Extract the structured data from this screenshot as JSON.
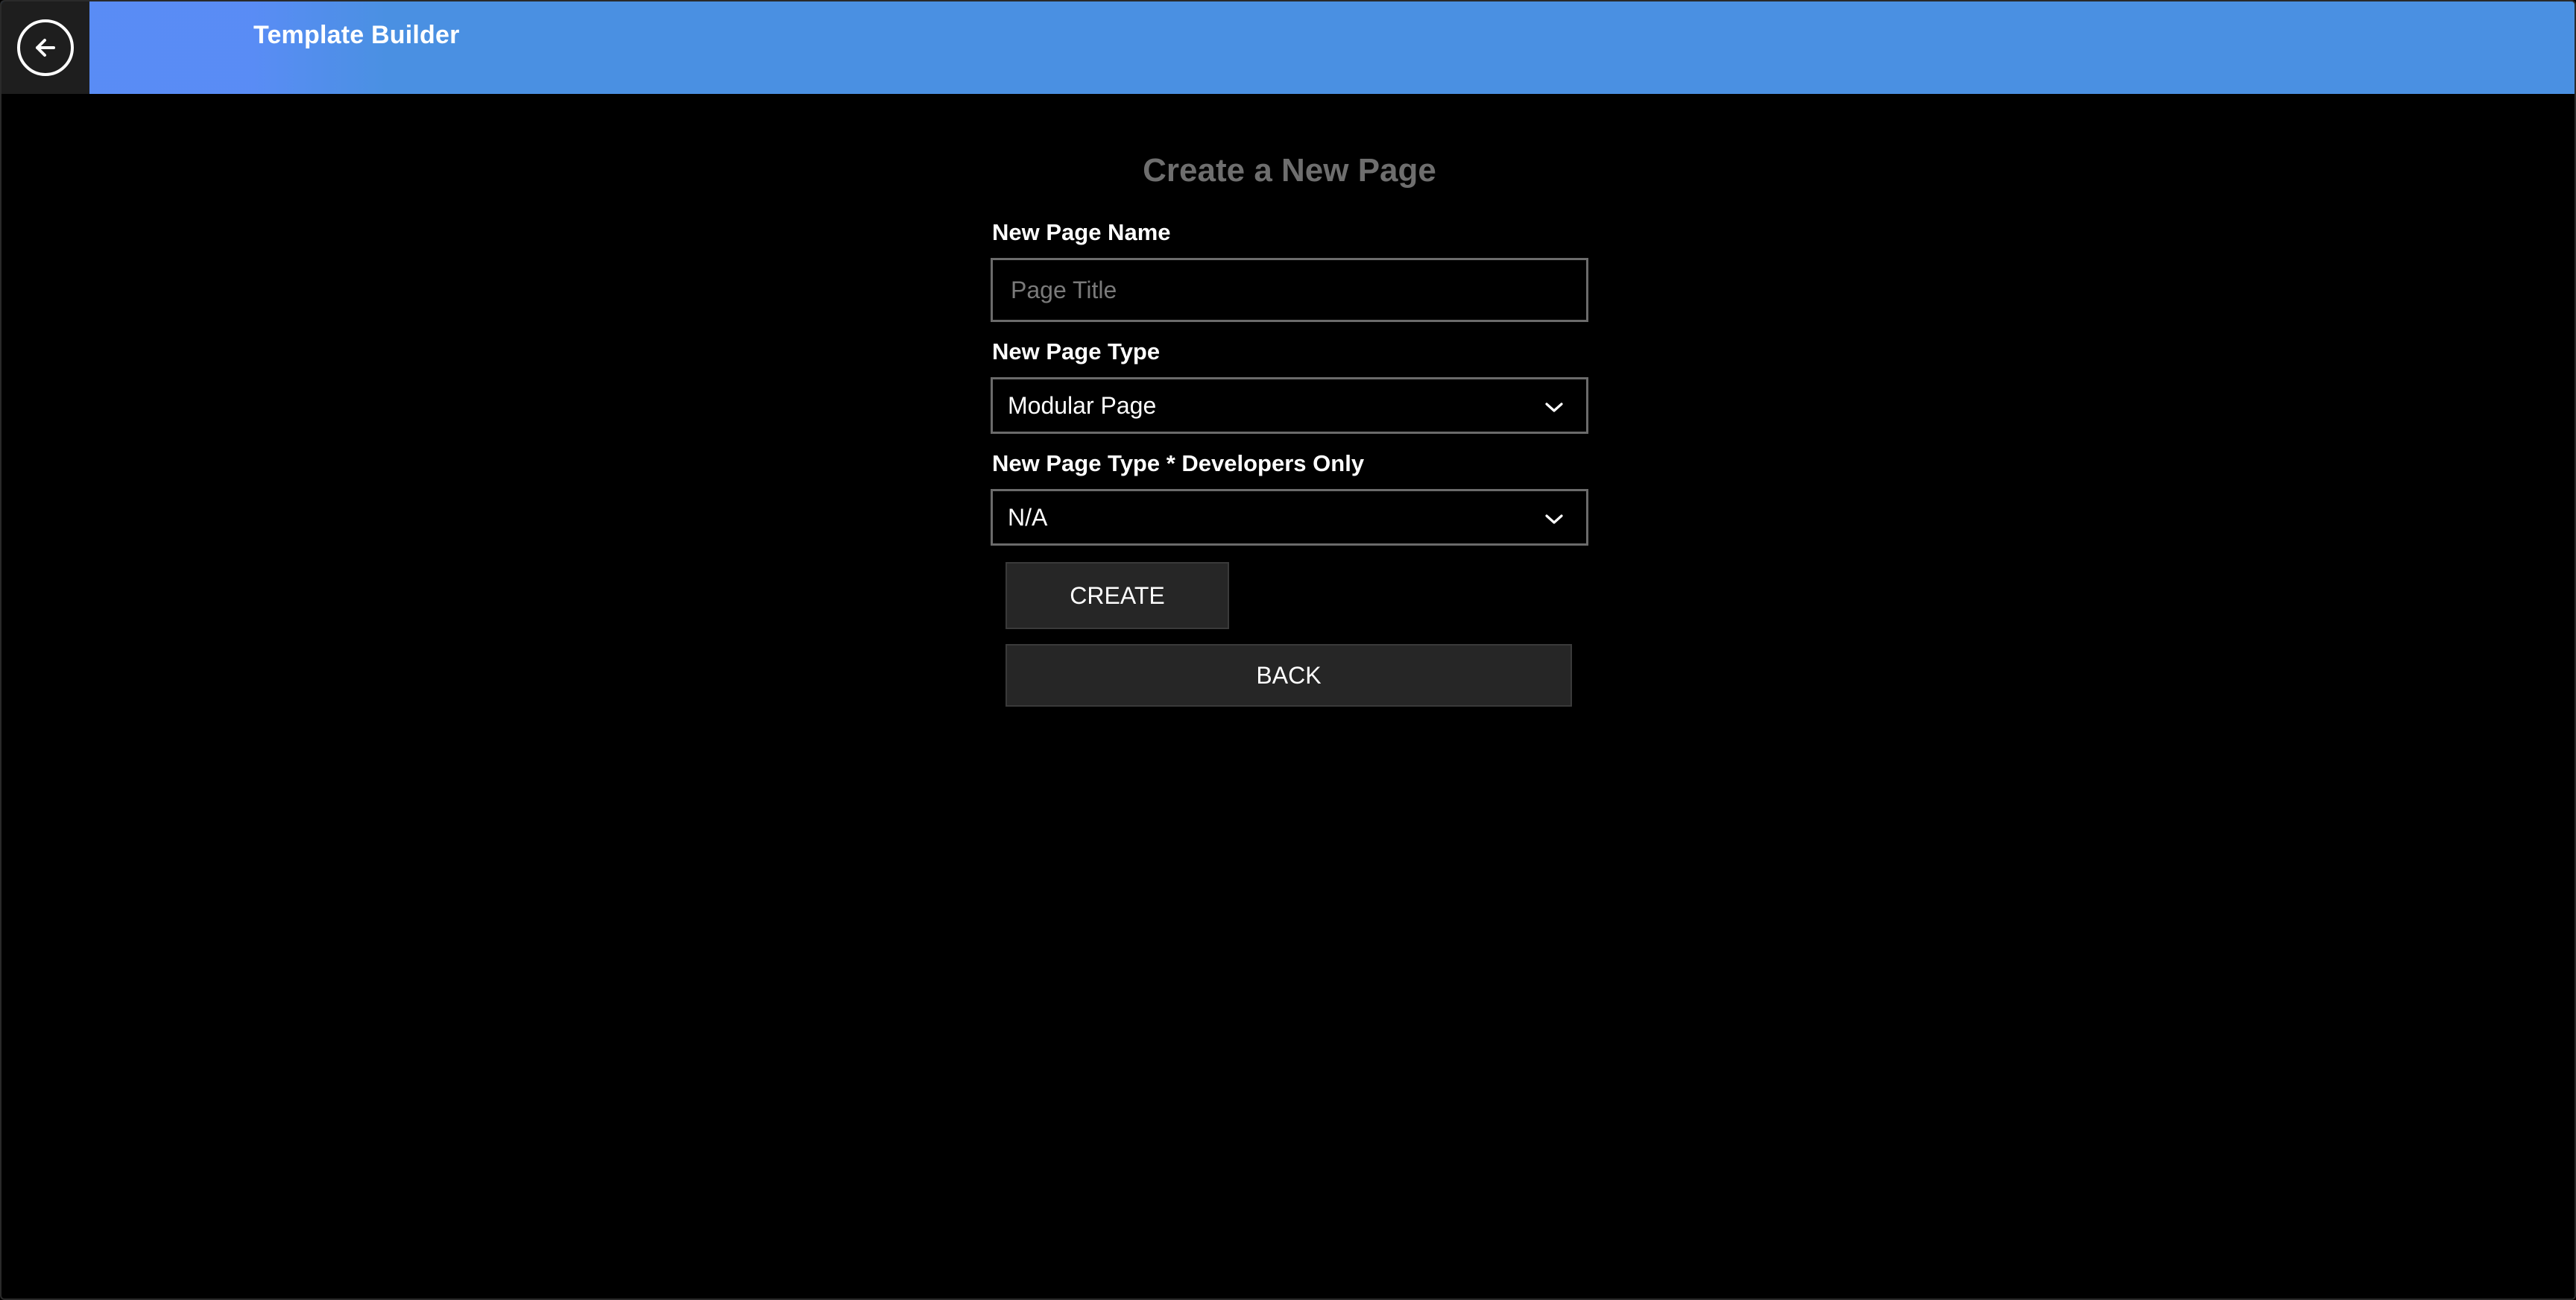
{
  "header": {
    "title": "Template Builder",
    "back_icon": "arrow-left-circle-icon",
    "bar_color": "#4a90e2",
    "accent_color": "#5b8cf7"
  },
  "form": {
    "heading": "Create a New Page",
    "page_name": {
      "label": "New Page Name",
      "placeholder": "Page Title",
      "value": ""
    },
    "page_type": {
      "label": "New Page Type",
      "selected": "Modular Page"
    },
    "dev_page_type": {
      "label": "New Page Type * Developers Only",
      "selected": "N/A"
    },
    "create_label": "CREATE",
    "back_label": "BACK"
  }
}
